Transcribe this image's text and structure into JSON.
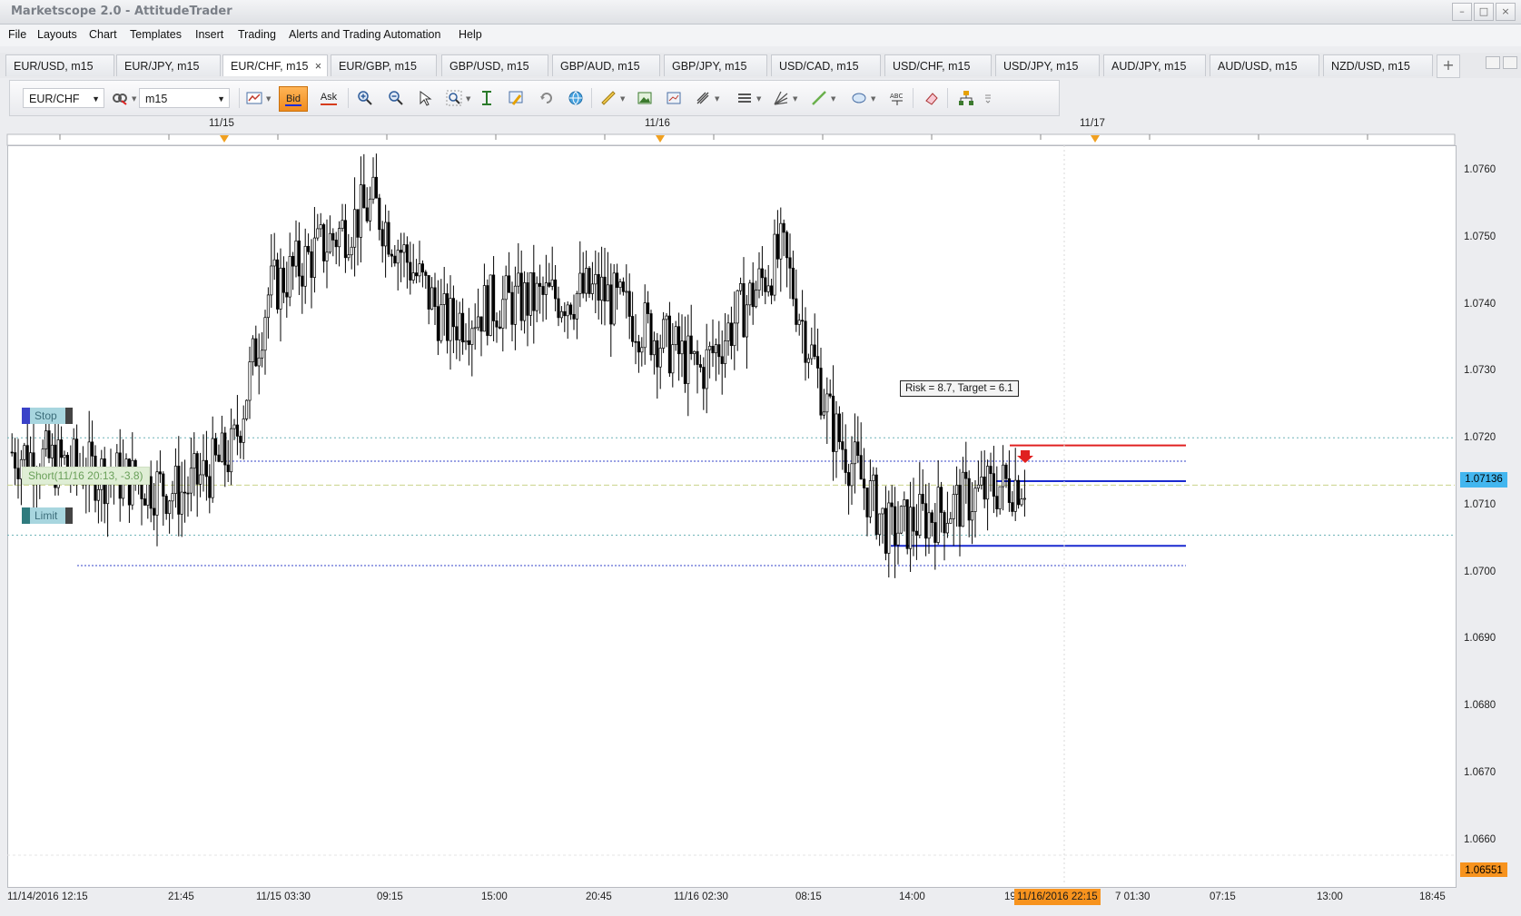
{
  "window": {
    "title": "Marketscope 2.0 - AttitudeTrader"
  },
  "menu": [
    "File",
    "Layouts",
    "Chart",
    "Templates",
    "Insert",
    "Trading",
    "Alerts and Trading Automation",
    "Help"
  ],
  "tabs": [
    "EUR/USD, m15",
    "EUR/JPY, m15",
    "EUR/CHF, m15",
    "EUR/GBP, m15",
    "GBP/USD, m15",
    "GBP/AUD, m15",
    "GBP/JPY, m15",
    "USD/CAD, m15",
    "USD/CHF, m15",
    "USD/JPY, m15",
    "AUD/JPY, m15",
    "AUD/USD, m15",
    "NZD/USD, m15"
  ],
  "active_tab_close": "×",
  "toolbar": {
    "instrument": "EUR/CHF",
    "timeframe": "m15",
    "bid_label": "Bid",
    "ask_label": "Ask"
  },
  "date_markers": [
    "11/15",
    "11/16",
    "11/17"
  ],
  "price_axis": [
    "1.0760",
    "1.0750",
    "1.0740",
    "1.0730",
    "1.0720",
    "1.0710",
    "1.0700",
    "1.0690",
    "1.0680",
    "1.0670",
    "1.0660"
  ],
  "current_price": "1.07136",
  "low_price": "1.06551",
  "time_axis": [
    "11/14/2016 12:15",
    "21:45",
    "11/15 03:30",
    "09:15",
    "15:00",
    "20:45",
    "11/16 02:30",
    "08:15",
    "14:00",
    "19",
    "7 01:30",
    "07:15",
    "13:00",
    "18:45"
  ],
  "cursor_time": "11/16/2016 22:15",
  "stop_label": "Stop",
  "limit_label": "Limit",
  "short_label": "Short(11/16 20:13, -3.8)",
  "risk_target_label": "Risk = 8.7, Target = 6.1",
  "colors": {
    "accent": "#f08c1e",
    "current_price": "#43b6ef",
    "stop_line": "#e02020",
    "entry_line": "#1a2ad0"
  },
  "chart_data": {
    "type": "candlestick",
    "symbol": "EUR/CHF",
    "timeframe": "m15",
    "ylim": [
      1.0655,
      1.0765
    ],
    "grid": false,
    "levels": {
      "stop": 1.072,
      "entry": 1.07136,
      "limit": 1.0706,
      "red_stop_line": 1.0719,
      "blue_target_line": 1.0704
    },
    "path_summary": [
      {
        "t": "11/14/2016 12:15",
        "close": 1.0718
      },
      {
        "t": "21:45",
        "close": 1.0712
      },
      {
        "t": "11/15 00:00",
        "close": 1.0718
      },
      {
        "t": "11/15 03:30",
        "close": 1.0742
      },
      {
        "t": "09:15",
        "close": 1.0755
      },
      {
        "t": "12:00",
        "close": 1.0737
      },
      {
        "t": "15:00",
        "close": 1.074
      },
      {
        "t": "20:45",
        "close": 1.0742
      },
      {
        "t": "11/16 02:30",
        "close": 1.073
      },
      {
        "t": "08:15",
        "close": 1.0748
      },
      {
        "t": "11:30",
        "close": 1.0722
      },
      {
        "t": "14:00",
        "close": 1.0706
      },
      {
        "t": "19:00",
        "close": 1.0713
      },
      {
        "t": "22:15",
        "close": 1.0714
      }
    ]
  }
}
